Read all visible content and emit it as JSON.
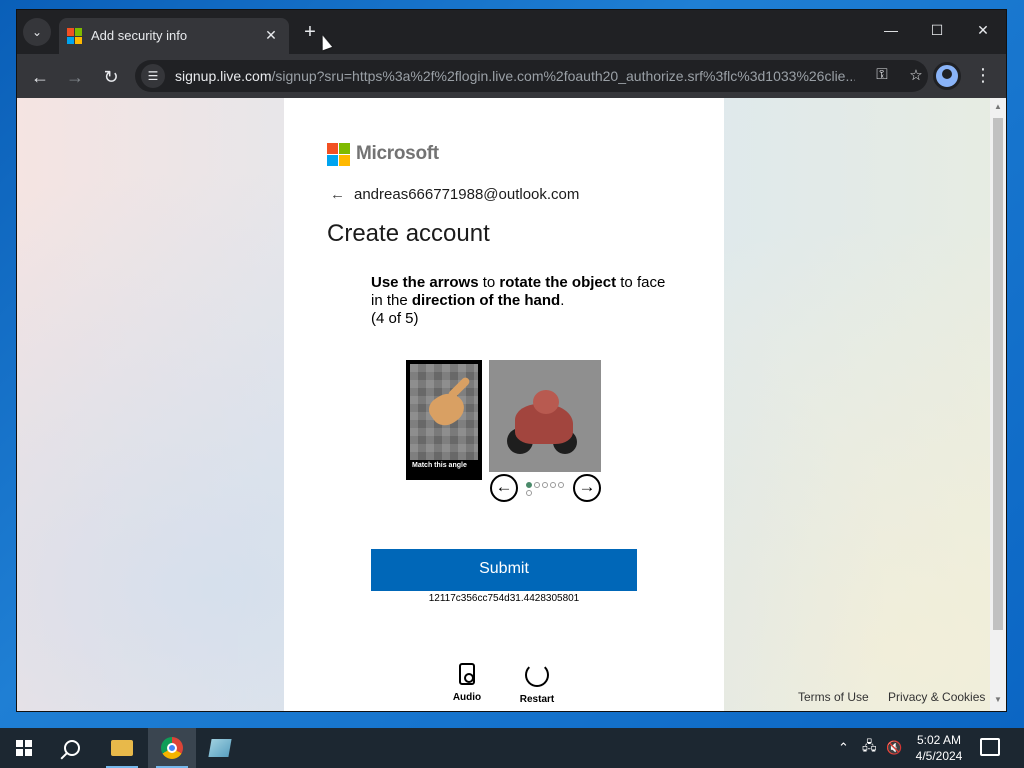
{
  "browser": {
    "tab_title": "Add security info",
    "url_host": "signup.live.com",
    "url_path": "/signup?sru=https%3a%2f%2flogin.live.com%2foauth20_authorize.srf%3flc%3d1033%26clie...",
    "new_tab_symbol": "+",
    "close_symbol": "✕"
  },
  "page": {
    "brand": "Microsoft",
    "email": "andreas666771988@outlook.com",
    "title": "Create account",
    "instruction": {
      "part1": "Use the arrows",
      "part2": " to ",
      "part3": "rotate the object",
      "part4": " to face in the ",
      "part5": "direction of the hand",
      "part6": ".",
      "progress": "(4 of 5)"
    },
    "match_label": "Match this angle",
    "submit_label": "Submit",
    "session_id": "12117c356cc754d31.4428305801",
    "audio_label": "Audio",
    "restart_label": "Restart",
    "footer": {
      "terms": "Terms of Use",
      "privacy": "Privacy & Cookies"
    }
  },
  "taskbar": {
    "time": "5:02 AM",
    "date": "4/5/2024"
  },
  "colors": {
    "ms_red": "#f25022",
    "ms_green": "#7fba00",
    "ms_blue": "#00a4ef",
    "ms_yellow": "#ffb900",
    "submit_bg": "#0067b8"
  },
  "icons": [
    "tab-search-icon",
    "microsoft-favicon",
    "close-icon",
    "new-tab-icon",
    "back-icon",
    "forward-icon",
    "reload-icon",
    "site-info-icon",
    "key-icon",
    "star-icon",
    "profile-icon",
    "more-icon",
    "back-arrow-icon",
    "audio-icon",
    "restart-icon",
    "windows-logo-icon",
    "search-icon",
    "file-explorer-icon",
    "chrome-icon",
    "app-icon"
  ]
}
